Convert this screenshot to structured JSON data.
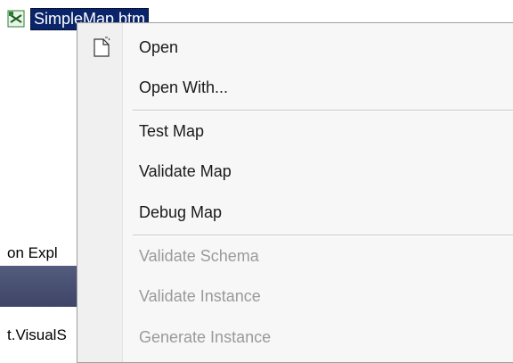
{
  "file": {
    "name": "SimpleMap.btm",
    "icon": "map-file-icon"
  },
  "background_pane": {
    "title": "on Expl",
    "item": "t.VisualS"
  },
  "menu": {
    "items": [
      {
        "label": "Open",
        "icon": "open-document-icon",
        "enabled": true
      },
      {
        "label": "Open With...",
        "enabled": true
      },
      {
        "label": "Test Map",
        "enabled": true
      },
      {
        "label": "Validate Map",
        "enabled": true
      },
      {
        "label": "Debug Map",
        "enabled": true
      },
      {
        "label": "Validate Schema",
        "enabled": false
      },
      {
        "label": "Validate Instance",
        "enabled": false
      },
      {
        "label": "Generate Instance",
        "enabled": false
      }
    ]
  },
  "colors": {
    "selection": "#0a246a",
    "disabled_text": "#9a9a9a",
    "menu_bg": "#f7f7f7"
  }
}
